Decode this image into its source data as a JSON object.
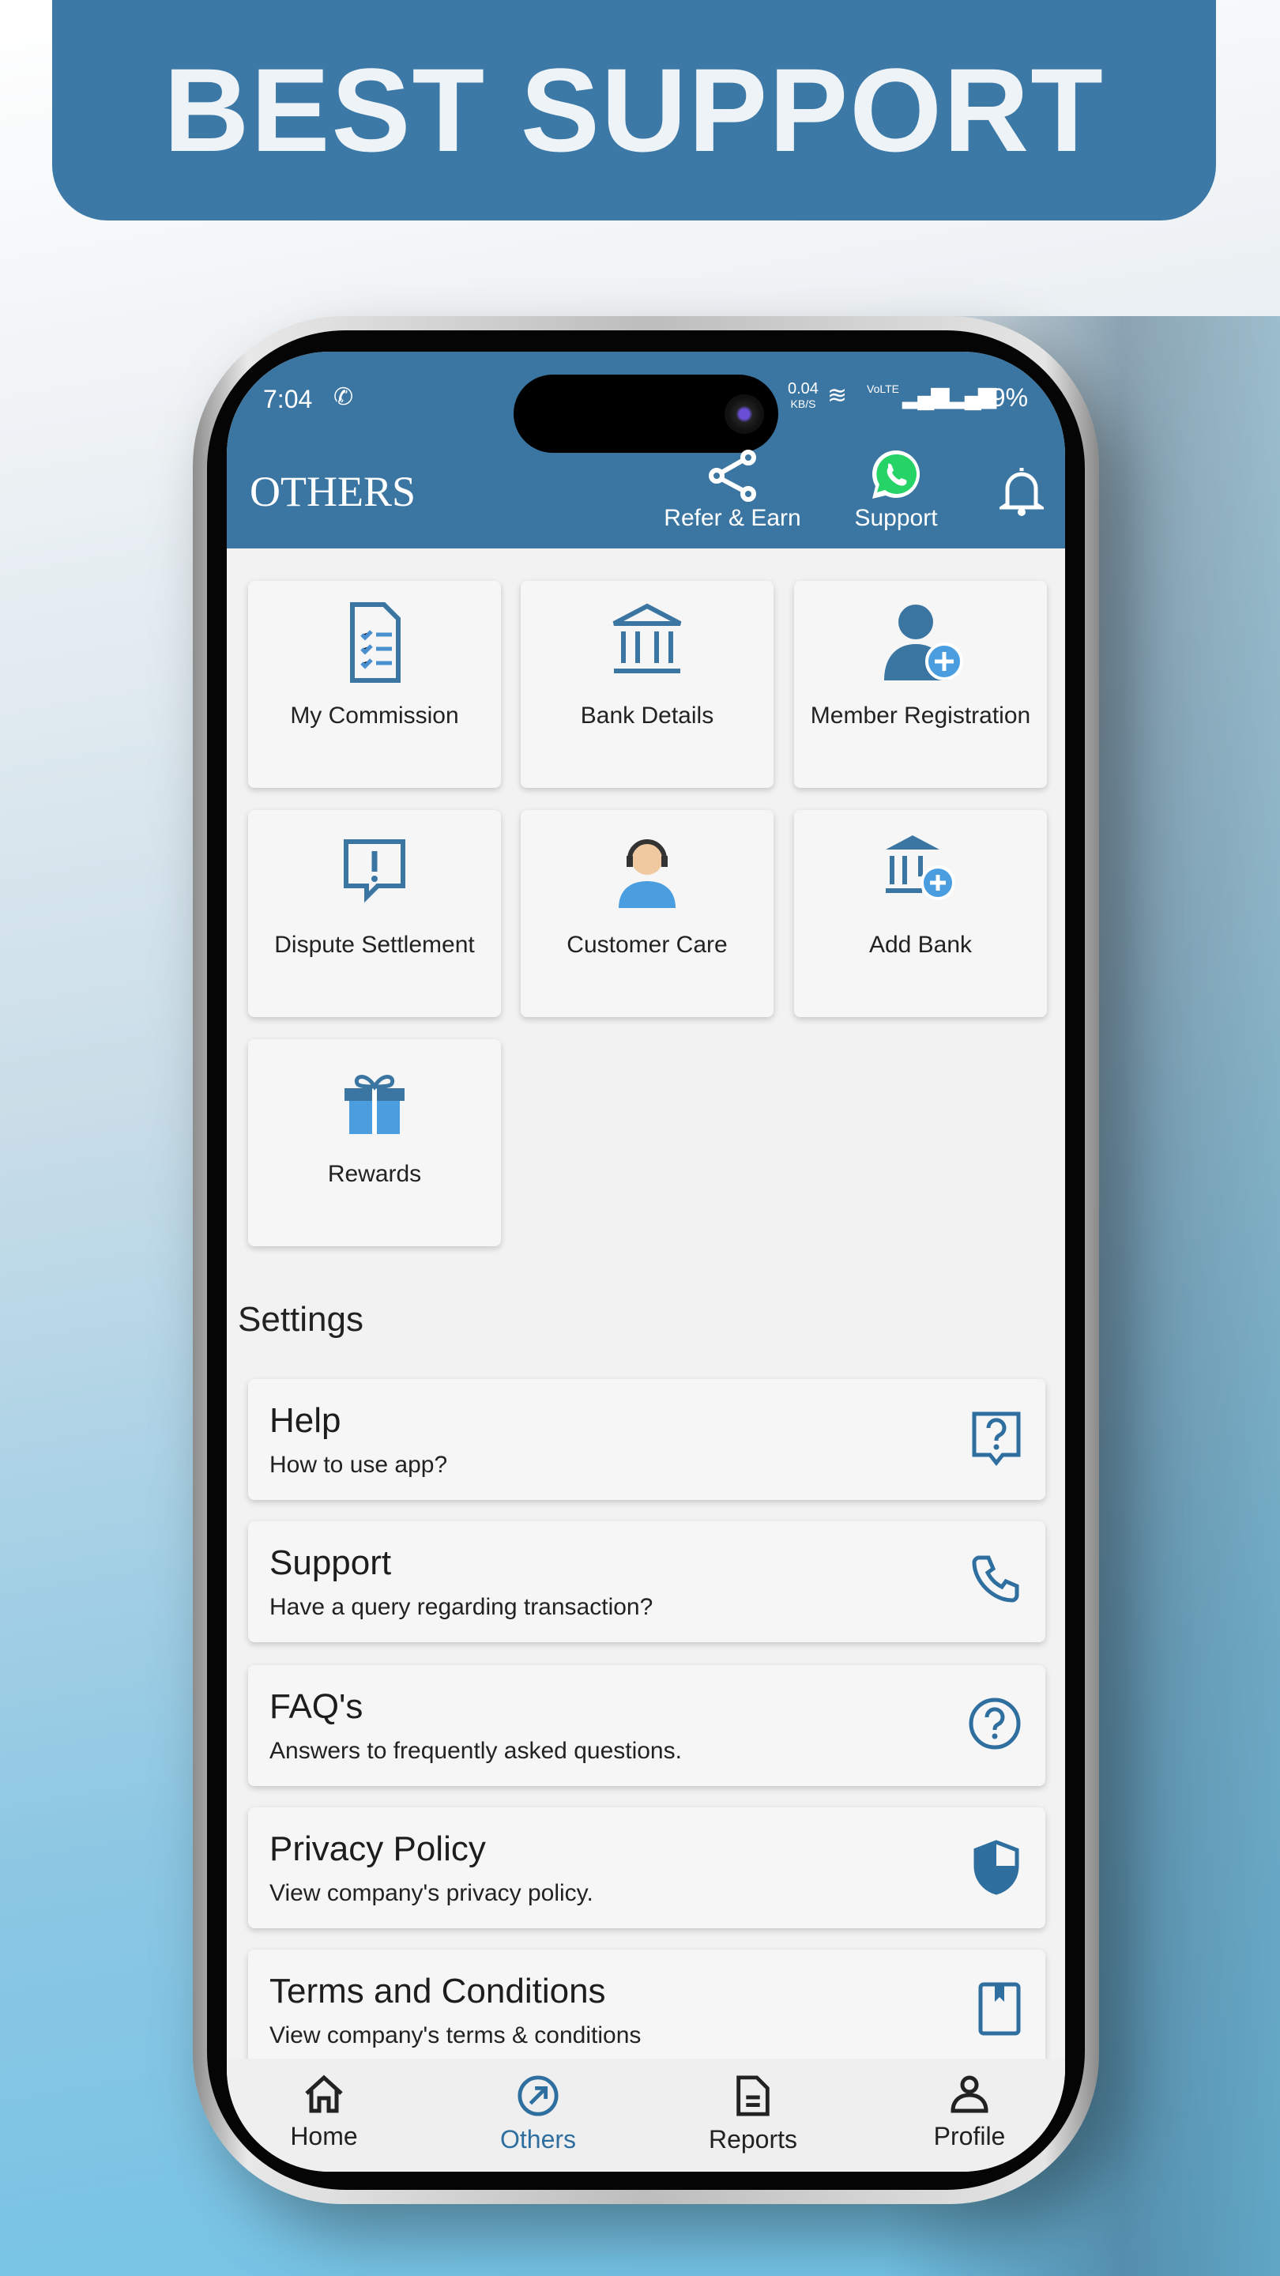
{
  "banner": {
    "title": "BEST SUPPORT"
  },
  "status_bar": {
    "time": "7:04",
    "net_speed": "0.04",
    "net_unit": "KB/S",
    "volte": "VoLTE",
    "battery": "49%"
  },
  "header": {
    "title": "OTHERS",
    "refer_label": "Refer & Earn",
    "support_label": "Support"
  },
  "grid": [
    {
      "label": "My Commission",
      "icon": "checklist-document-icon"
    },
    {
      "label": "Bank Details",
      "icon": "bank-icon"
    },
    {
      "label": "Member Registration",
      "icon": "add-user-icon"
    },
    {
      "label": "Dispute Settlement",
      "icon": "alert-message-icon"
    },
    {
      "label": "Customer Care",
      "icon": "headset-agent-icon"
    },
    {
      "label": "Add Bank",
      "icon": "add-bank-icon"
    },
    {
      "label": "Rewards",
      "icon": "gift-icon"
    }
  ],
  "settings": {
    "heading": "Settings",
    "items": [
      {
        "title": "Help",
        "subtitle": "How to use app?",
        "icon": "help-message-icon"
      },
      {
        "title": "Support",
        "subtitle": "Have a query regarding transaction?",
        "icon": "phone-icon"
      },
      {
        "title": "FAQ's",
        "subtitle": "Answers to frequently asked questions.",
        "icon": "question-circle-icon"
      },
      {
        "title": "Privacy Policy",
        "subtitle": "View company's privacy policy.",
        "icon": "shield-icon"
      },
      {
        "title": "Terms and Conditions",
        "subtitle": "View company's terms & conditions",
        "icon": "book-icon"
      }
    ]
  },
  "nav": {
    "items": [
      {
        "label": "Home"
      },
      {
        "label": "Others",
        "active": true
      },
      {
        "label": "Reports"
      },
      {
        "label": "Profile"
      }
    ]
  },
  "colors": {
    "primary": "#3b76a3",
    "active": "#2f6fa0",
    "whatsapp": "#25d366"
  }
}
